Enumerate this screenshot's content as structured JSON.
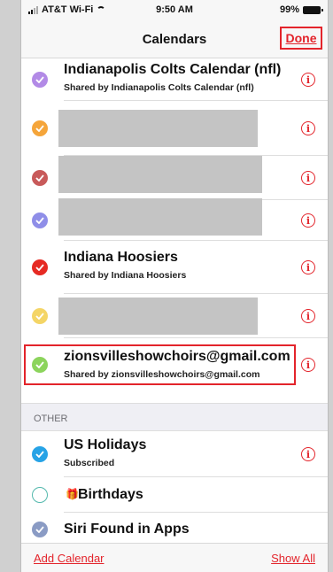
{
  "status_bar": {
    "carrier": "AT&T Wi-Fi",
    "time": "9:50 AM",
    "battery": "99%"
  },
  "nav": {
    "title": "Calendars",
    "done_label": "Done"
  },
  "calendars": [
    {
      "title": "Indianapolis Colts Calendar (nfl)",
      "subtitle": "Shared by Indianapolis Colts Calendar (nfl)",
      "color": "#b28ae6",
      "checked": true,
      "redacted": false
    },
    {
      "title": "",
      "subtitle": "",
      "color": "#f5a53a",
      "checked": true,
      "redacted": true
    },
    {
      "title": "",
      "subtitle": "",
      "color": "#c85a5a",
      "checked": true,
      "redacted": true
    },
    {
      "title": "",
      "subtitle": "",
      "color": "#8f8ee8",
      "checked": true,
      "redacted": true
    },
    {
      "title": "Indiana Hoosiers",
      "subtitle": "Shared by Indiana Hoosiers",
      "color": "#e62a23",
      "checked": true,
      "redacted": false
    },
    {
      "title": "",
      "subtitle": "",
      "color": "#f4d566",
      "checked": true,
      "redacted": true
    },
    {
      "title": "zionsvilleshowchoirs@gmail.com",
      "subtitle": "Shared by zionsvilleshowchoirs@gmail.com",
      "color": "#8cd45c",
      "checked": true,
      "redacted": false
    }
  ],
  "other_section": {
    "header": "OTHER",
    "items": [
      {
        "title": "US Holidays",
        "subtitle": "Subscribed",
        "color": "#27a3e6",
        "checked": true
      },
      {
        "title": "Birthdays",
        "icon": "gift-icon",
        "color": "#54b9ad",
        "checked": false
      },
      {
        "title": "Siri Found in Apps",
        "color": "#8a9bc4",
        "checked": true
      }
    ]
  },
  "toolbar": {
    "add_calendar": "Add Calendar",
    "show_all": "Show All"
  },
  "colors": {
    "accent": "#e3242b",
    "redaction": "#c4c4c4"
  }
}
